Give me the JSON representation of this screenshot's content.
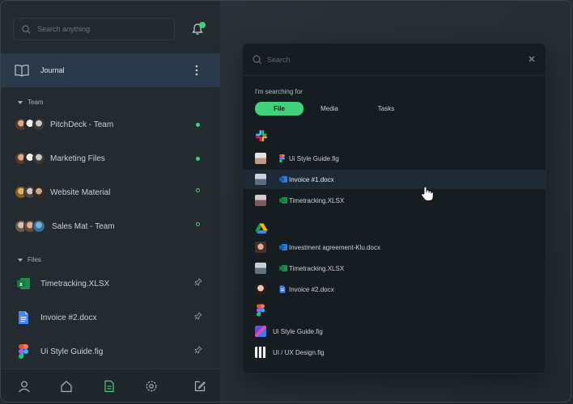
{
  "sidebar": {
    "search": {
      "placeholder": "Search anything"
    },
    "notification_badge": "",
    "journal": {
      "label": "Journal"
    },
    "team_section": {
      "label": "Team"
    },
    "team_items": [
      {
        "label": "PitchDeck - Team",
        "status": "online"
      },
      {
        "label": "Marketing Files",
        "status": "online"
      },
      {
        "label": "Website Material",
        "status": "offline"
      },
      {
        "label": "Sales Mat - Team",
        "status": "offline"
      }
    ],
    "files_section": {
      "label": "Files"
    },
    "file_items": [
      {
        "label": "Timetracking.XLSX",
        "icon": "excel-icon"
      },
      {
        "label": "Invoice #2.docx",
        "icon": "google-docs-icon"
      },
      {
        "label": "Ui Style Guide.fig",
        "icon": "figma-icon"
      }
    ],
    "bottom_nav": [
      "user-icon",
      "home-icon",
      "document-icon",
      "gear-icon",
      "compose-icon"
    ]
  },
  "search_panel": {
    "placeholder": "Search",
    "searching_for_label": "I'm searching for",
    "tabs": [
      {
        "label": "File",
        "active": true
      },
      {
        "label": "Media",
        "active": false
      },
      {
        "label": "Tasks",
        "active": false
      }
    ],
    "groups": [
      {
        "source": "slack-icon",
        "results": [
          {
            "label": "Ui Style Guide.fig",
            "icon": "figma-icon"
          },
          {
            "label": "Invoice #1.docx",
            "icon": "word-icon",
            "highlighted": true
          },
          {
            "label": "Timetracking.XLSX",
            "icon": "excel-icon"
          }
        ]
      },
      {
        "source": "google-drive-icon",
        "results": [
          {
            "label": "Investment agreement-Klu.docx",
            "icon": "word-icon"
          },
          {
            "label": "Timetracking.XLSX",
            "icon": "excel-icon"
          },
          {
            "label": "Invoice #2.docx",
            "icon": "google-docs-icon"
          }
        ]
      },
      {
        "source": "figma-icon",
        "results": [
          {
            "label": "Ui Style Guide.fig",
            "icon": "figma-thumbnail"
          },
          {
            "label": "UI / UX Design.fig",
            "icon": "figma-thumbnail"
          }
        ]
      }
    ]
  },
  "colors": {
    "accent": "#41d07c",
    "sidebar_bg": "#232a30",
    "panel_bg": "#161d21",
    "highlight_row": "#1d2a36",
    "journal_row": "#2a3a4a"
  }
}
